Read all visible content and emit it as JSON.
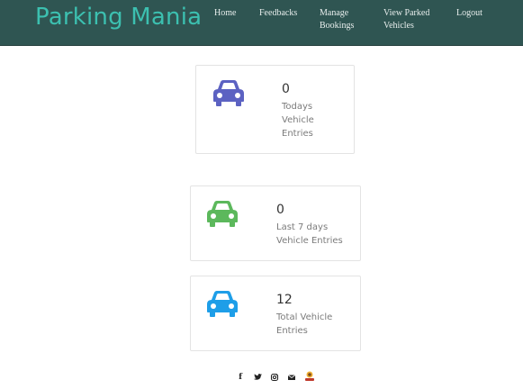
{
  "header": {
    "brand": "Parking Mania",
    "nav": {
      "home": "Home",
      "feedbacks": "Feedbacks",
      "manage_bookings_1": "Manage",
      "manage_bookings_2": "Bookings",
      "view_parked_1": "View Parked",
      "view_parked_2": "Vehicles",
      "logout": "Logout"
    }
  },
  "cards": [
    {
      "count": "0",
      "label_lines": [
        "Todays",
        "Vehicle",
        "Entries"
      ],
      "icon": "car-icon",
      "color": "#5c62c2"
    },
    {
      "count": "0",
      "label_lines": [
        "Last 7 days",
        "Vehicle Entries"
      ],
      "icon": "car-icon",
      "color": "#5cb85c"
    },
    {
      "count": "12",
      "label_lines": [
        "Total Vehicle",
        "Entries"
      ],
      "icon": "car-icon",
      "color": "#1e9ee8"
    }
  ],
  "footer": {
    "icons": [
      "facebook-icon",
      "twitter-icon",
      "instagram-icon",
      "envelope-icon",
      "parking-logo"
    ],
    "facebook": "f",
    "twitter": "t",
    "instagram": "◎",
    "envelope": "✉"
  }
}
